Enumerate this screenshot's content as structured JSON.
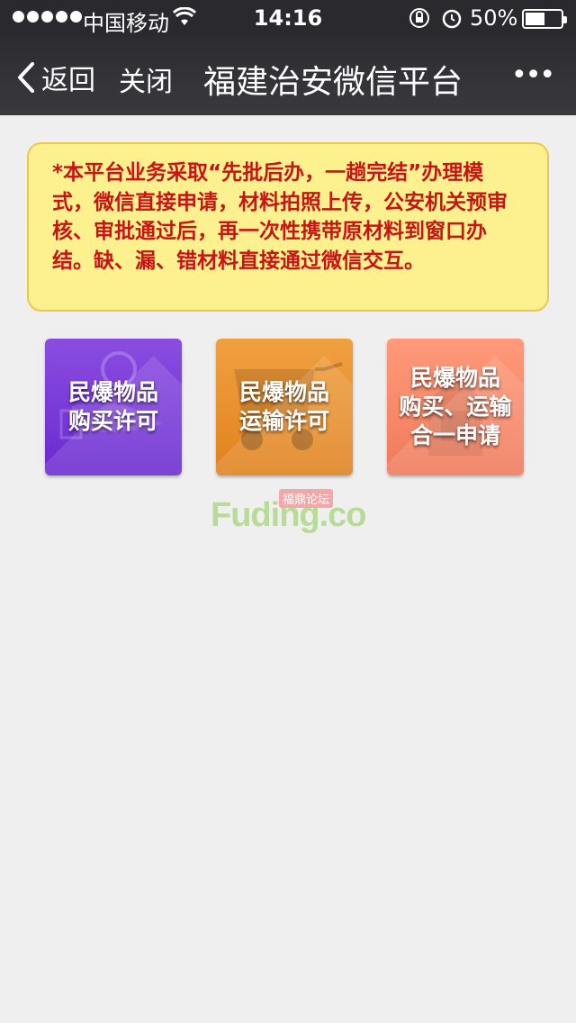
{
  "status_bar": {
    "carrier": "中国移动",
    "time": "14:16",
    "battery_percent": "50%",
    "battery_level": 0.5,
    "signal_bars": 5
  },
  "navbar": {
    "back_label": "返回",
    "close_label": "关闭",
    "title": "福建治安微信平台",
    "more_label": "•••"
  },
  "notice": {
    "text": "*本平台业务采取“先批后办，一趟完结”办理模式，微信直接申请，材料拍照上传，公安机关预审核、审批通过后，再一次性携带原材料到窗口办结。缺、漏、错材料直接通过微信交互。"
  },
  "tiles": [
    {
      "line1": "民爆物品",
      "line2": "购买许可",
      "icon": "money-bag-icon",
      "color": "#7a3ad8"
    },
    {
      "line1": "民爆物品",
      "line2": "运输许可",
      "icon": "cart-icon",
      "color": "#e98e2c"
    },
    {
      "line1": "民爆物品",
      "line2": "购买、运输",
      "line3": "合一申请",
      "icon": "document-icon",
      "color": "#f8896a"
    }
  ],
  "watermark": {
    "text": "Fuding.co",
    "badge": "福鼎论坛"
  }
}
